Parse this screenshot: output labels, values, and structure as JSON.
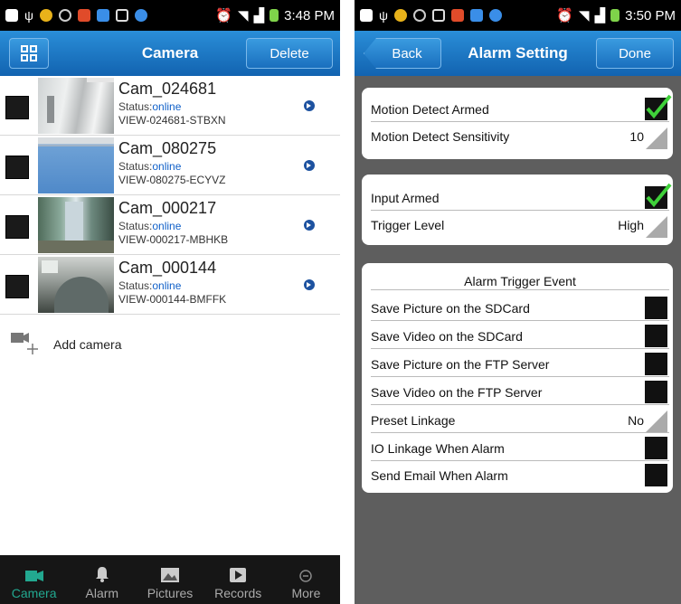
{
  "left": {
    "status_time": "3:48 PM",
    "nav": {
      "title": "Camera",
      "delete_label": "Delete"
    },
    "cameras": [
      {
        "name": "Cam_024681",
        "status_label": "Status:",
        "status": "online",
        "id": "VIEW-024681-STBXN"
      },
      {
        "name": "Cam_080275",
        "status_label": "Status:",
        "status": "online",
        "id": "VIEW-080275-ECYVZ"
      },
      {
        "name": "Cam_000217",
        "status_label": "Status:",
        "status": "online",
        "id": "VIEW-000217-MBHKB"
      },
      {
        "name": "Cam_000144",
        "status_label": "Status:",
        "status": "online",
        "id": "VIEW-000144-BMFFK"
      }
    ],
    "add_camera_label": "Add camera",
    "tabs": [
      {
        "label": "Camera",
        "icon": "camera-icon",
        "active": true
      },
      {
        "label": "Alarm",
        "icon": "bell-icon"
      },
      {
        "label": "Pictures",
        "icon": "picture-icon"
      },
      {
        "label": "Records",
        "icon": "record-icon"
      },
      {
        "label": "More",
        "icon": "more-icon"
      }
    ]
  },
  "right": {
    "status_time": "3:50 PM",
    "nav": {
      "back_label": "Back",
      "title": "Alarm Setting",
      "done_label": "Done"
    },
    "motion": {
      "armed_label": "Motion Detect Armed",
      "armed": true,
      "sensitivity_label": "Motion Detect Sensitivity",
      "sensitivity_value": "10"
    },
    "input": {
      "armed_label": "Input Armed",
      "armed": true,
      "trigger_label": "Trigger Level",
      "trigger_value": "High"
    },
    "trigger_event": {
      "title": "Alarm Trigger Event",
      "save_pic_sd": "Save Picture on the SDCard",
      "save_vid_sd": "Save Video on the SDCard",
      "save_pic_ftp": "Save Picture on the FTP Server",
      "save_vid_ftp": "Save Video on the FTP Server",
      "preset_label": "Preset Linkage",
      "preset_value": "No",
      "io_linkage": "IO Linkage When Alarm",
      "send_email": "Send Email When Alarm"
    }
  },
  "colors": {
    "accent": "#1a6fbe",
    "online": "#1060c8",
    "tab_active": "#22a890",
    "check": "#3fd13a"
  }
}
